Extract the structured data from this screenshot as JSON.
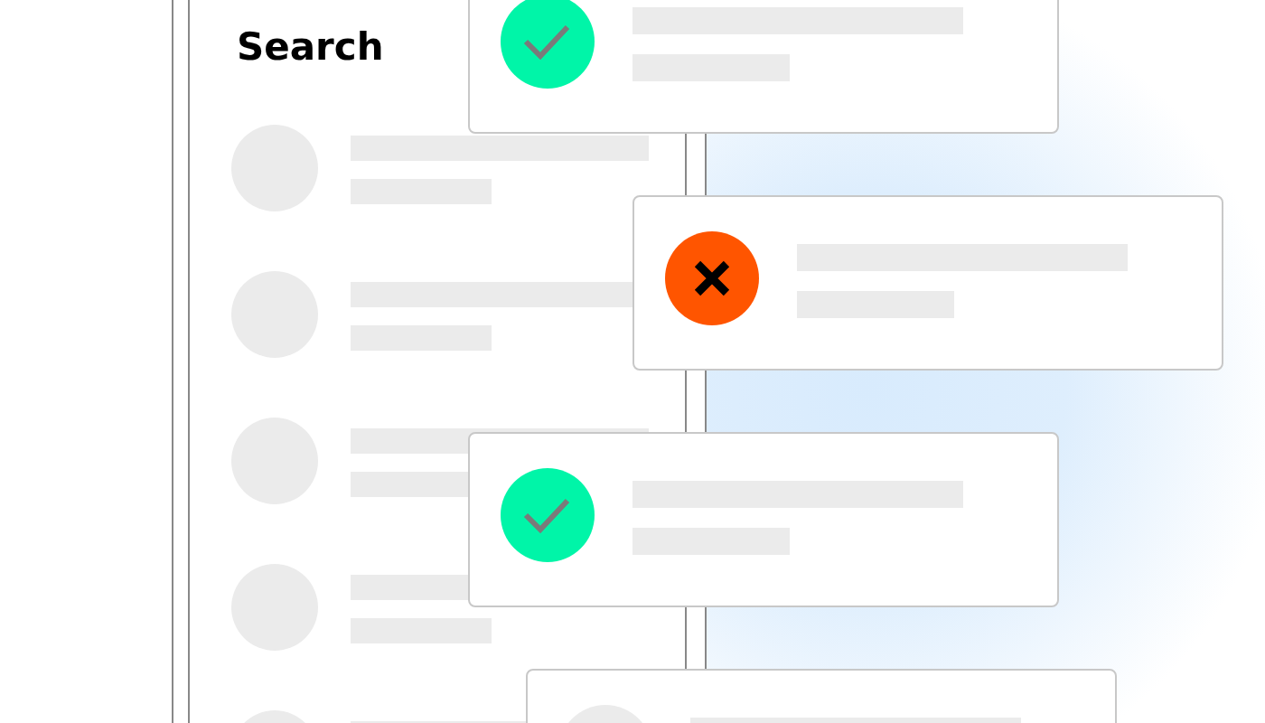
{
  "screen": {
    "title": "Search",
    "rows": [
      {
        "kind": "skeleton",
        "lines": [
          {
            "kind": "long"
          },
          {
            "kind": "short"
          }
        ]
      },
      {
        "kind": "skeleton",
        "lines": [
          {
            "kind": "long"
          },
          {
            "kind": "short"
          }
        ]
      },
      {
        "kind": "skeleton",
        "lines": [
          {
            "kind": "long"
          },
          {
            "kind": "short"
          }
        ]
      },
      {
        "kind": "skeleton",
        "lines": [
          {
            "kind": "long"
          },
          {
            "kind": "short"
          }
        ]
      },
      {
        "kind": "skeleton",
        "lines": [
          {
            "kind": "long"
          }
        ]
      }
    ]
  },
  "notifications": [
    {
      "kind": "success",
      "color": "#00f5a8",
      "lines": [
        {
          "kind": "long"
        },
        {
          "kind": "short"
        }
      ]
    },
    {
      "kind": "error",
      "color": "#ff5500",
      "lines": [
        {
          "kind": "long"
        },
        {
          "kind": "short"
        }
      ]
    },
    {
      "kind": "success",
      "color": "#00f5a8",
      "lines": [
        {
          "kind": "long"
        },
        {
          "kind": "short"
        }
      ]
    },
    {
      "kind": "pending",
      "color": "#ebebeb",
      "lines": [
        {
          "kind": "long"
        }
      ]
    }
  ]
}
